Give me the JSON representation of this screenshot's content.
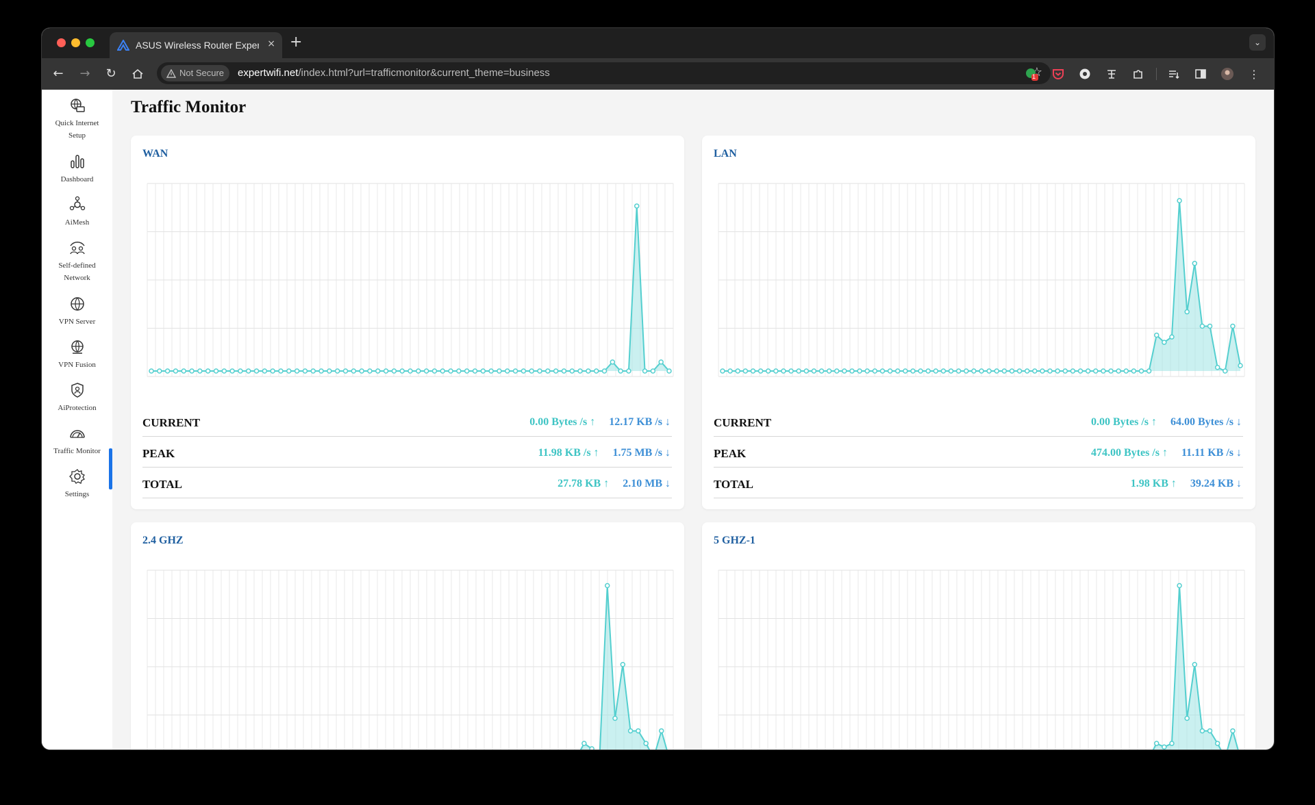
{
  "browser": {
    "tab_title": "ASUS Wireless Router Exper",
    "tab_close": "×",
    "new_tab": "+",
    "security_chip": "Not Secure",
    "url_domain": "expertwifi.net",
    "url_path": "/index.html?url=trafficmonitor&current_theme=business",
    "extension_badge": "1"
  },
  "sidebar": {
    "items": [
      {
        "label_line1": "Quick Internet",
        "label_line2": "Setup",
        "icon": "globe-setup-icon"
      },
      {
        "label_line1": "Dashboard",
        "icon": "bar-chart-icon"
      },
      {
        "label_line1": "AiMesh",
        "icon": "mesh-icon"
      },
      {
        "label_line1": "Self-defined",
        "label_line2": "Network",
        "icon": "network-people-icon"
      },
      {
        "label_line1": "VPN Server",
        "icon": "globe-icon"
      },
      {
        "label_line1": "VPN Fusion",
        "icon": "globe-fusion-icon"
      },
      {
        "label_line1": "AiProtection",
        "icon": "shield-icon"
      },
      {
        "label_line1": "Traffic Monitor",
        "icon": "gauge-icon",
        "active": true
      },
      {
        "label_line1": "Settings",
        "icon": "gear-icon"
      }
    ]
  },
  "page": {
    "title": "Traffic Monitor"
  },
  "stat_labels": {
    "current": "CURRENT",
    "peak": "PEAK",
    "total": "TOTAL"
  },
  "cards": {
    "wan": {
      "title": "WAN",
      "current_up": "0.00 Bytes /s",
      "current_down": "12.17 KB /s",
      "peak_up": "11.98 KB /s",
      "peak_down": "1.75 MB /s",
      "total_up": "27.78 KB",
      "total_down": "2.10 MB"
    },
    "lan": {
      "title": "LAN",
      "current_up": "0.00 Bytes /s",
      "current_down": "64.00 Bytes /s",
      "peak_up": "474.00 Bytes /s",
      "peak_down": "11.11 KB /s",
      "total_up": "1.98 KB",
      "total_down": "39.24 KB"
    },
    "ghz24": {
      "title": "2.4 GHZ"
    },
    "ghz5": {
      "title": "5 GHZ-1"
    }
  },
  "colors": {
    "series_fill": "#9fe3e3",
    "series_line": "#54cfcf",
    "up": "#3ec4c4",
    "down": "#3d8fd6",
    "active_bar": "#1a73e8"
  },
  "chart_data": [
    {
      "type": "area",
      "name": "WAN",
      "y_peak_index": 59,
      "series": [
        {
          "values": [
            0,
            0,
            0,
            0,
            0,
            0,
            0,
            0,
            0,
            0,
            0,
            0,
            0,
            0,
            0,
            0,
            0,
            0,
            0,
            0,
            0,
            0,
            0,
            0,
            0,
            0,
            0,
            0,
            0,
            0,
            0,
            0,
            0,
            0,
            0,
            0,
            0,
            0,
            0,
            0,
            0,
            0,
            0,
            0,
            0,
            0,
            0,
            0,
            0,
            0,
            0,
            0,
            0,
            0,
            0,
            0,
            0,
            5,
            0,
            0,
            92,
            0,
            0,
            5,
            0
          ]
        }
      ]
    },
    {
      "type": "area",
      "name": "LAN",
      "series": [
        {
          "values": [
            0,
            0,
            0,
            0,
            0,
            0,
            0,
            0,
            0,
            0,
            0,
            0,
            0,
            0,
            0,
            0,
            0,
            0,
            0,
            0,
            0,
            0,
            0,
            0,
            0,
            0,
            0,
            0,
            0,
            0,
            0,
            0,
            0,
            0,
            0,
            0,
            0,
            0,
            0,
            0,
            0,
            0,
            0,
            0,
            0,
            0,
            0,
            0,
            0,
            0,
            0,
            0,
            0,
            0,
            0,
            0,
            0,
            20,
            16,
            19,
            95,
            33,
            60,
            25,
            25,
            2,
            0,
            25,
            3
          ]
        }
      ]
    },
    {
      "type": "area",
      "name": "2.4 GHZ",
      "series": [
        {
          "values": [
            0,
            0,
            0,
            0,
            0,
            0,
            0,
            0,
            0,
            0,
            0,
            0,
            0,
            0,
            0,
            0,
            0,
            0,
            0,
            0,
            0,
            0,
            0,
            0,
            0,
            0,
            0,
            0,
            0,
            0,
            0,
            0,
            0,
            0,
            0,
            0,
            0,
            0,
            0,
            0,
            0,
            0,
            0,
            0,
            0,
            0,
            0,
            0,
            0,
            0,
            0,
            0,
            0,
            0,
            0,
            0,
            8,
            5,
            0,
            96,
            22,
            52,
            15,
            15,
            8,
            0,
            15,
            0
          ]
        }
      ]
    },
    {
      "type": "area",
      "name": "5 GHZ-1",
      "series": [
        {
          "values": [
            0,
            0,
            0,
            0,
            0,
            0,
            0,
            0,
            0,
            0,
            0,
            0,
            0,
            0,
            0,
            0,
            0,
            0,
            0,
            0,
            0,
            0,
            0,
            0,
            0,
            0,
            0,
            0,
            0,
            0,
            0,
            0,
            0,
            0,
            0,
            0,
            0,
            0,
            0,
            0,
            0,
            0,
            0,
            0,
            0,
            0,
            0,
            0,
            0,
            0,
            0,
            0,
            0,
            0,
            0,
            0,
            0,
            8,
            6,
            8,
            96,
            22,
            52,
            15,
            15,
            8,
            0,
            15,
            0
          ]
        }
      ]
    }
  ]
}
